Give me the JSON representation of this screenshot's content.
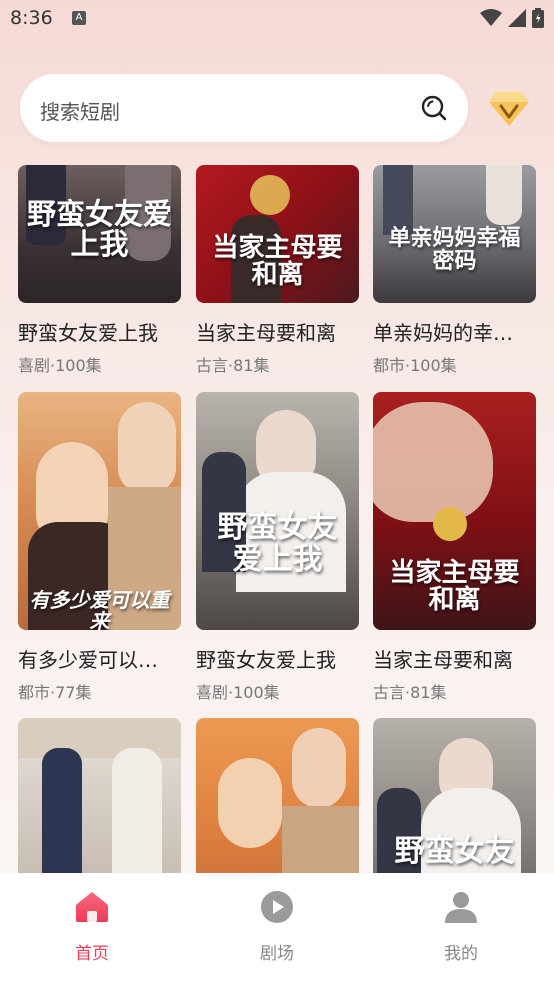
{
  "status": {
    "time": "8:36",
    "notification_glyph": "A"
  },
  "search": {
    "placeholder": "搜索短剧"
  },
  "colors": {
    "accent": "#ef3f5c",
    "vip": "#e8a92a"
  },
  "rows": [
    [
      {
        "title": "野蛮女友爱上我",
        "meta": "喜剧·100集",
        "poster_text": "野蛮女友爱上我"
      },
      {
        "title": "当家主母要和离",
        "meta": "古言·81集",
        "poster_text": "当家主母要和离"
      },
      {
        "title": "单亲妈妈的幸…",
        "meta": "都市·100集",
        "poster_text": "单亲妈妈幸福密码"
      }
    ],
    [
      {
        "title": "有多少爱可以…",
        "meta": "都市·77集",
        "poster_text": "有多少爱可以重来"
      },
      {
        "title": "野蛮女友爱上我",
        "meta": "喜剧·100集",
        "poster_text": "野蛮女友爱上我"
      },
      {
        "title": "当家主母要和离",
        "meta": "古言·81集",
        "poster_text": "当家主母要和离"
      }
    ],
    [
      {
        "poster_text": ""
      },
      {
        "poster_text": ""
      },
      {
        "poster_text": "野蛮女友"
      }
    ]
  ],
  "nav": [
    {
      "label": "首页",
      "icon": "home-icon",
      "active": true
    },
    {
      "label": "剧场",
      "icon": "play-icon",
      "active": false
    },
    {
      "label": "我的",
      "icon": "profile-icon",
      "active": false
    }
  ]
}
